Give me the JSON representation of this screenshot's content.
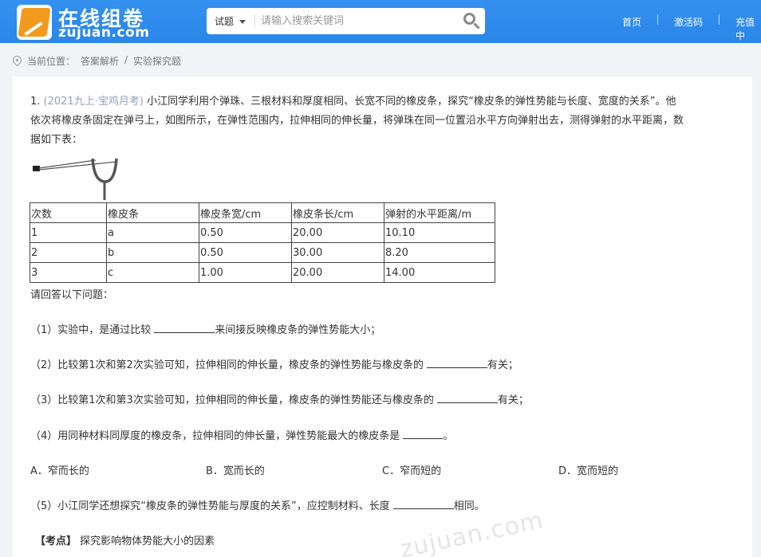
{
  "header": {
    "logo_title": "在线组卷",
    "logo_sub": "zujuan.com",
    "search": {
      "type_label": "试题",
      "placeholder": "请输入搜索关键词"
    },
    "nav": [
      "首页",
      "激活码",
      "充值中"
    ]
  },
  "breadcrumb": {
    "prefix": "当前位置：",
    "items": [
      "答案解析",
      "/",
      "实验探究题"
    ]
  },
  "question": {
    "number": "1.",
    "source": "(2021九上·宝鸡月考)",
    "stem_line1": "小江同学利用个弹珠、三根材料和厚度相同、长宽不同的橡皮条，探究“橡皮条的弹性势能与长度、宽度的关系”。他",
    "stem_line2": "依次将橡皮条固定在弹弓上，如图所示，在弹性范围内，拉伸相同的伸长量，将弹珠在同一位置沿水平方向弹射出去，测得弹射的水平距离，数",
    "stem_line3": "据如下表："
  },
  "table": {
    "headers": [
      "次数",
      "橡皮条",
      "橡皮条宽/cm",
      "橡皮条长/cm",
      "弹射的水平距离/m"
    ],
    "rows": [
      [
        "1",
        "a",
        "0.50",
        "20.00",
        "10.10"
      ],
      [
        "2",
        "b",
        "0.50",
        "30.00",
        "8.20"
      ],
      [
        "3",
        "c",
        "1.00",
        "20.00",
        "14.00"
      ]
    ]
  },
  "answer_prompt": "请回答以下问题：",
  "sub_questions": {
    "q1_pre": "（1）实验中，是通过比较",
    "q1_post": "来间接反映橡皮条的弹性势能大小；",
    "q2_pre": "（2）比较第1次和第2次实验可知，拉伸相同的伸长量，橡皮条的弹性势能与橡皮条的",
    "q2_post": "有关；",
    "q3_pre": "（3）比较第1次和第3次实验可知，拉伸相同的伸长量，橡皮条的弹性势能还与橡皮条的",
    "q3_post": "有关；",
    "q4_pre": "（4）用同种材料同厚度的橡皮条，拉伸相同的伸长量，弹性势能最大的橡皮条是",
    "q4_post": "。",
    "q5_pre": "（5）小江同学还想探究“橡皮条的弹性势能与厚度的关系”，应控制材料、长度",
    "q5_post": "相同。"
  },
  "options": [
    "A．窄而长的",
    "B．宽而长的",
    "C．窄而短的",
    "D．宽而短的"
  ],
  "kaodian": {
    "label": "【考点】",
    "text": "探究影响物体势能大小的因素"
  },
  "watermark": "zujuan.com"
}
